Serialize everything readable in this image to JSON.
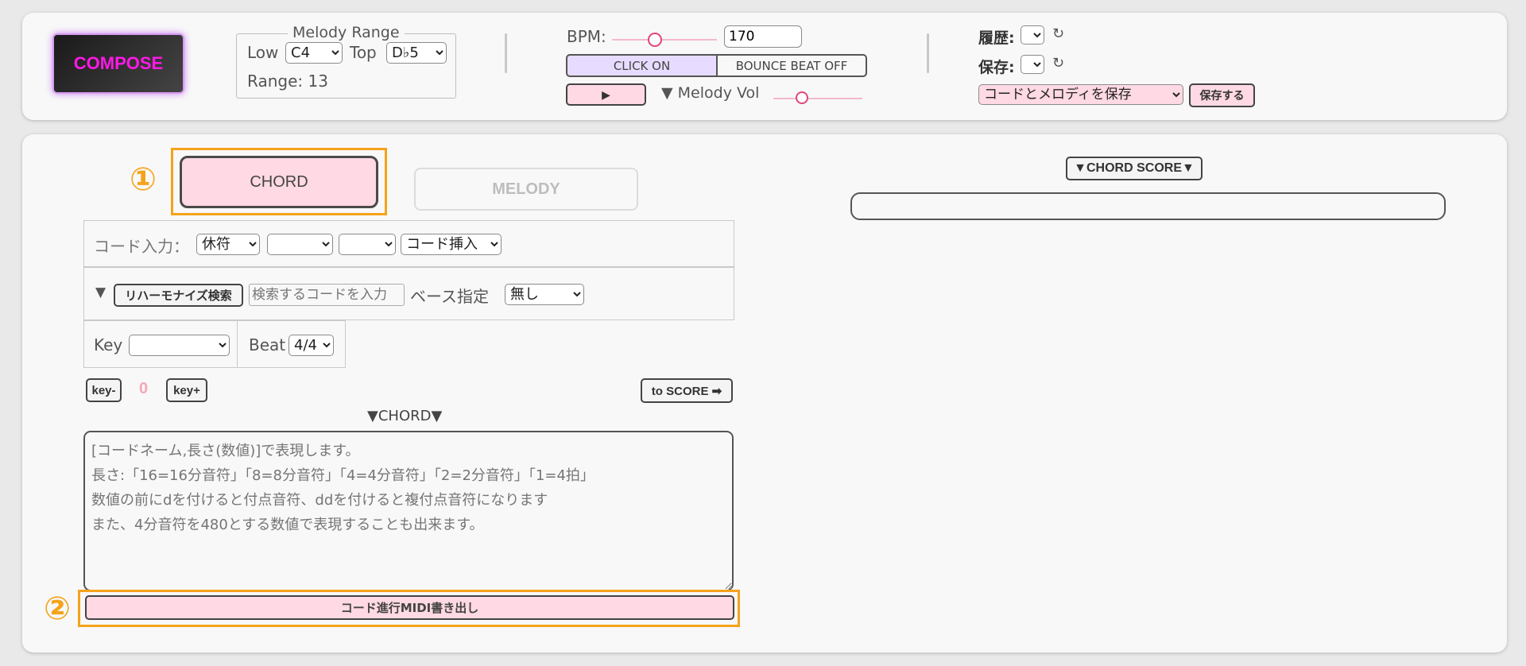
{
  "compose_button": "COMPOSE",
  "melody_range": {
    "legend": "Melody Range",
    "low_label": "Low",
    "low_value": "C4",
    "top_label": "Top",
    "top_value": "D♭5",
    "range_text": "Range: 13"
  },
  "tempo": {
    "bpm_label": "BPM:",
    "bpm_value": "170",
    "click_button": "CLICK ON",
    "bounce_button": "BOUNCE BEAT OFF",
    "play_icon": "▶",
    "melody_vol_label": "▼ Melody Vol"
  },
  "history": {
    "history_label": "履歴:",
    "save_label": "保存:",
    "refresh_icon": "↻",
    "save_option": "コードとメロディを保存",
    "save_button": "保存する"
  },
  "tabs": {
    "chord": "CHORD",
    "melody": "MELODY"
  },
  "chord_input": {
    "label": "コード入力：",
    "rest_option": "休符",
    "insert_option": "コード挿入"
  },
  "reharm": {
    "toggle": "▼",
    "search_button": "リハーモナイズ検索",
    "search_placeholder": "検索するコードを入力",
    "bass_label": "ベース指定",
    "bass_value": "無し"
  },
  "key_beat": {
    "key_label": "Key",
    "key_value": "",
    "beat_label": "Beat",
    "beat_value": "4/4"
  },
  "transpose": {
    "key_minus": "key-",
    "value": "0",
    "key_plus": "key+",
    "to_score": "to SCORE ➡"
  },
  "chord_heading": "▼CHORD▼",
  "chord_textarea_placeholder": "[コードネーム,長さ(数値)]で表現します。\n長さ:「16=16分音符」「8=8分音符」「4=4分音符」「2=2分音符」「1=4拍」\n数値の前にdを付けると付点音符、ddを付けると複付点音符になります\nまた、4分音符を480とする数値で表現することも出来ます。",
  "export_button": "コード進行MIDI書き出し",
  "chord_score_button": "▼CHORD SCORE▼",
  "annotations": {
    "one": "①",
    "two": "②"
  },
  "colors": {
    "accent_pink": "#ffd9e3",
    "compose_text": "#ff19e6",
    "click_on_bg": "#e7dcff",
    "annotation_orange": "#f5a31a",
    "transpose_value": "#f6a6b8"
  }
}
